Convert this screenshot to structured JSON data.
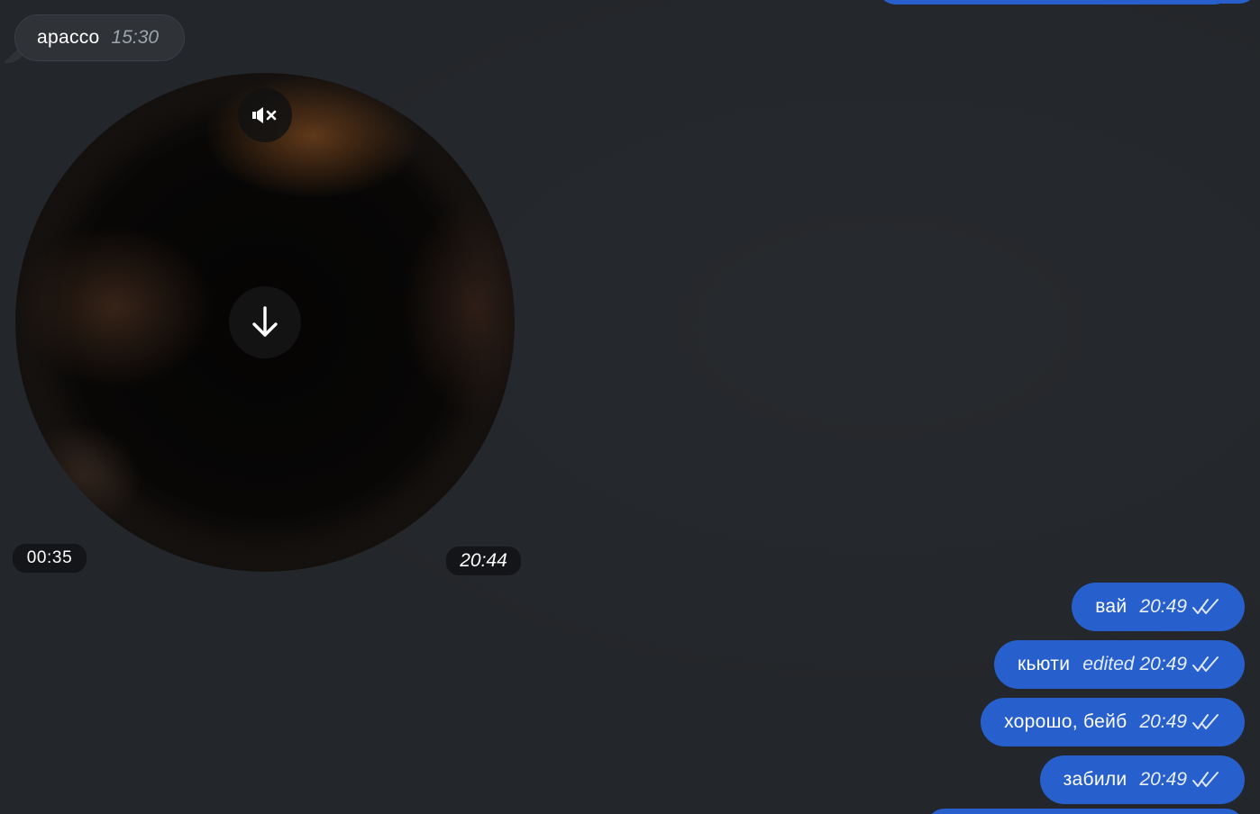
{
  "incoming_message": {
    "text": "apacco",
    "time": "15:30"
  },
  "video_message": {
    "duration": "00:35",
    "time": "20:44",
    "muted_icon": "speaker-muted-icon",
    "download_icon": "download-arrow-icon"
  },
  "outgoing_messages": [
    {
      "text": "вай",
      "edited": "",
      "time": "20:49",
      "status_icon": "double-check-icon"
    },
    {
      "text": "кьюти",
      "edited": "edited",
      "time": "20:49",
      "status_icon": "double-check-icon"
    },
    {
      "text": "хорошо, бейб",
      "edited": "",
      "time": "20:49",
      "status_icon": "double-check-icon"
    },
    {
      "text": "забили",
      "edited": "",
      "time": "20:49",
      "status_icon": "double-check-icon"
    }
  ],
  "colors": {
    "background": "#23262a",
    "outgoing_bubble": "#2760cc",
    "incoming_bubble": "#2f3237"
  }
}
